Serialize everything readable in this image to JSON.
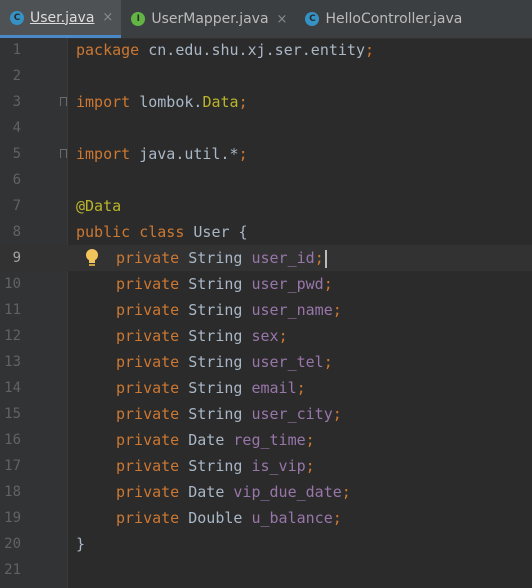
{
  "tabs": [
    {
      "label": "User.java",
      "icon": "class-icon",
      "active": true,
      "closable": true
    },
    {
      "label": "UserMapper.java",
      "icon": "interface-icon",
      "active": false,
      "closable": true
    },
    {
      "label": "HelloController.java",
      "icon": "class-icon",
      "active": false,
      "closable": false
    }
  ],
  "tab_close_glyph": "×",
  "icon_letters": {
    "class": "C",
    "interface": "I"
  },
  "editor": {
    "current_line": 9,
    "lines": [
      {
        "n": "1",
        "tokens": [
          {
            "t": "package",
            "c": "kw"
          },
          {
            "t": " cn.edu.shu.xj.ser.entity",
            "c": "pkg"
          },
          {
            "t": ";",
            "c": "kw"
          }
        ]
      },
      {
        "n": "2",
        "tokens": []
      },
      {
        "n": "3",
        "tokens": [
          {
            "t": "import",
            "c": "kw"
          },
          {
            "t": " lombok.",
            "c": "pkg"
          },
          {
            "t": "Data",
            "c": "ann"
          },
          {
            "t": ";",
            "c": "kw"
          }
        ]
      },
      {
        "n": "4",
        "tokens": []
      },
      {
        "n": "5",
        "tokens": [
          {
            "t": "import",
            "c": "kw"
          },
          {
            "t": " java.util.*",
            "c": "pkg"
          },
          {
            "t": ";",
            "c": "kw"
          }
        ]
      },
      {
        "n": "6",
        "tokens": []
      },
      {
        "n": "7",
        "tokens": [
          {
            "t": "@Data",
            "c": "ann"
          }
        ]
      },
      {
        "n": "8",
        "tokens": [
          {
            "t": "public",
            "c": "kw"
          },
          {
            "t": " ",
            "c": "pkg"
          },
          {
            "t": "class",
            "c": "kw"
          },
          {
            "t": " User {",
            "c": "pkg"
          }
        ]
      },
      {
        "n": "9",
        "tokens": [
          {
            "t": "private",
            "c": "kw"
          },
          {
            "t": " String ",
            "c": "pkg"
          },
          {
            "t": "user_id",
            "c": "fld"
          },
          {
            "t": ";",
            "c": "kw"
          }
        ]
      },
      {
        "n": "10",
        "tokens": [
          {
            "t": "private",
            "c": "kw"
          },
          {
            "t": " String ",
            "c": "pkg"
          },
          {
            "t": "user_pwd",
            "c": "fld"
          },
          {
            "t": ";",
            "c": "kw"
          }
        ]
      },
      {
        "n": "11",
        "tokens": [
          {
            "t": "private",
            "c": "kw"
          },
          {
            "t": " String ",
            "c": "pkg"
          },
          {
            "t": "user_name",
            "c": "fld"
          },
          {
            "t": ";",
            "c": "kw"
          }
        ]
      },
      {
        "n": "12",
        "tokens": [
          {
            "t": "private",
            "c": "kw"
          },
          {
            "t": " String ",
            "c": "pkg"
          },
          {
            "t": "sex",
            "c": "fld"
          },
          {
            "t": ";",
            "c": "kw"
          }
        ]
      },
      {
        "n": "13",
        "tokens": [
          {
            "t": "private",
            "c": "kw"
          },
          {
            "t": " String ",
            "c": "pkg"
          },
          {
            "t": "user_tel",
            "c": "fld"
          },
          {
            "t": ";",
            "c": "kw"
          }
        ]
      },
      {
        "n": "14",
        "tokens": [
          {
            "t": "private",
            "c": "kw"
          },
          {
            "t": " String ",
            "c": "pkg"
          },
          {
            "t": "email",
            "c": "fld"
          },
          {
            "t": ";",
            "c": "kw"
          }
        ]
      },
      {
        "n": "15",
        "tokens": [
          {
            "t": "private",
            "c": "kw"
          },
          {
            "t": " String ",
            "c": "pkg"
          },
          {
            "t": "user_city",
            "c": "fld"
          },
          {
            "t": ";",
            "c": "kw"
          }
        ]
      },
      {
        "n": "16",
        "tokens": [
          {
            "t": "private",
            "c": "kw"
          },
          {
            "t": " Date ",
            "c": "pkg"
          },
          {
            "t": "reg_time",
            "c": "fld"
          },
          {
            "t": ";",
            "c": "kw"
          }
        ]
      },
      {
        "n": "17",
        "tokens": [
          {
            "t": "private",
            "c": "kw"
          },
          {
            "t": " String ",
            "c": "pkg"
          },
          {
            "t": "is_vip",
            "c": "fld"
          },
          {
            "t": ";",
            "c": "kw"
          }
        ]
      },
      {
        "n": "18",
        "tokens": [
          {
            "t": "private",
            "c": "kw"
          },
          {
            "t": " Date ",
            "c": "pkg"
          },
          {
            "t": "vip_due_date",
            "c": "fld"
          },
          {
            "t": ";",
            "c": "kw"
          }
        ]
      },
      {
        "n": "19",
        "tokens": [
          {
            "t": "private",
            "c": "kw"
          },
          {
            "t": " Double ",
            "c": "pkg"
          },
          {
            "t": "u_balance",
            "c": "fld"
          },
          {
            "t": ";",
            "c": "kw"
          }
        ]
      },
      {
        "n": "20",
        "tokens": [
          {
            "t": "}",
            "c": "pkg"
          }
        ]
      },
      {
        "n": "21",
        "tokens": []
      }
    ]
  },
  "colors": {
    "background": "#2b2b2b",
    "gutter": "#313335",
    "keyword": "#cc7832",
    "annotation": "#bbb529",
    "field": "#9876aa",
    "text": "#a9b7c6",
    "active_tab_underline": "#4a88c7"
  }
}
